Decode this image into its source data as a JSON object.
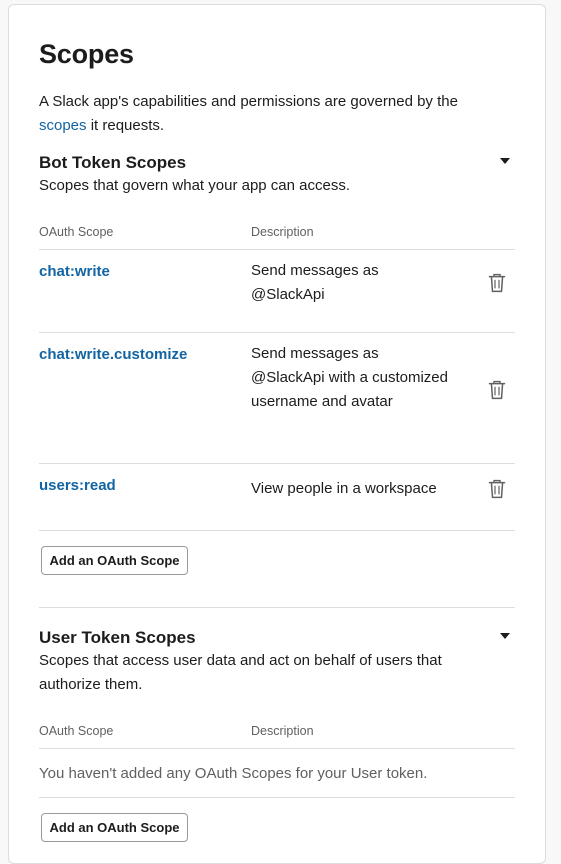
{
  "page": {
    "title": "Scopes",
    "intro_before": "A Slack app's capabilities and permissions are governed by the",
    "intro_link": "scopes",
    "intro_after": " it requests."
  },
  "bot": {
    "title": "Bot Token Scopes",
    "description": "Scopes that govern what your app can access.",
    "col_scope": "OAuth Scope",
    "col_desc": "Description",
    "rows": [
      {
        "scope": "chat:write",
        "description": "Send messages as @SlackApi"
      },
      {
        "scope": "chat:write.customize",
        "description": "Send messages as @SlackApi with a customized username and avatar"
      },
      {
        "scope": "users:read",
        "description": "View people in a workspace"
      }
    ],
    "add_button": "Add an OAuth Scope"
  },
  "user": {
    "title": "User Token Scopes",
    "description": "Scopes that access user data and act on behalf of users that authorize them.",
    "col_scope": "OAuth Scope",
    "col_desc": "Description",
    "empty_message": "You haven't added any OAuth Scopes for your User token.",
    "add_button": "Add an OAuth Scope"
  },
  "icons": {
    "caret": "caret-down-icon",
    "trash": "trash-icon"
  },
  "colors": {
    "link": "#1264a3",
    "text": "#1d1c1d",
    "muted": "#616061",
    "divider": "#dddddd"
  }
}
